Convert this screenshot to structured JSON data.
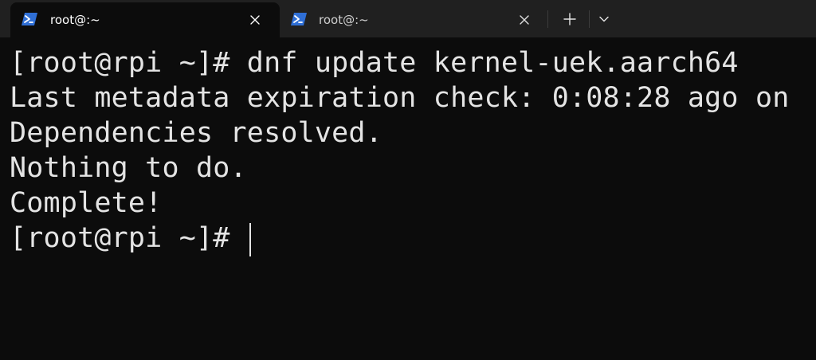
{
  "tabs": [
    {
      "title": "root@:~",
      "icon": "powershell-icon",
      "active": true,
      "close_glyph": "✕"
    },
    {
      "title": "root@:~",
      "icon": "powershell-icon",
      "active": false,
      "close_glyph": "✕"
    }
  ],
  "tabbar": {
    "new_tab_glyph": "+",
    "dropdown_glyph": "⌄"
  },
  "terminal": {
    "lines": [
      "[root@rpi ~]# dnf update kernel-uek.aarch64",
      "Last metadata expiration check: 0:08:28 ago on",
      "Dependencies resolved.",
      "Nothing to do.",
      "Complete!",
      "[root@rpi ~]# "
    ],
    "foreground": "#e4e4e4",
    "background": "#0c0c0c"
  },
  "colors": {
    "tabbar_bg": "#202020",
    "icon_blue": "#2f6fd6"
  }
}
